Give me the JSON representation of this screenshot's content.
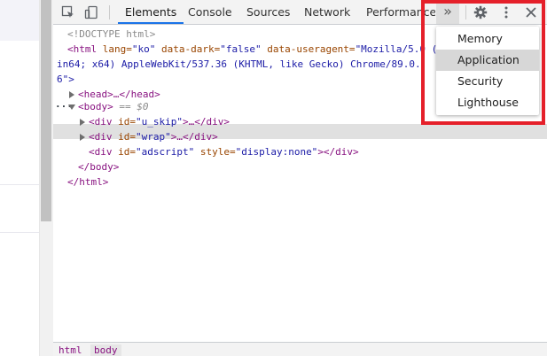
{
  "toolbar": {
    "tabs": [
      "Elements",
      "Console",
      "Sources",
      "Network",
      "Performance"
    ],
    "active_tab": "Elements",
    "overflow_label": "»",
    "icons": [
      "inspect-icon",
      "device-toggle-icon",
      "gear-icon",
      "more-vert-icon",
      "close-icon"
    ]
  },
  "code": {
    "doctype": "<!DOCTYPE html>",
    "html_open_tag": "<html",
    "html_attr1_name": " lang=",
    "html_attr1_val": "\"ko\"",
    "html_attr2_name": " data-dark=",
    "html_attr2_val": "\"false\"",
    "html_attr3_name": " data-useragent=",
    "html_attr3_val_part1": "\"Mozilla/5.0 (",
    "useragent_line2": "in64; x64) AppleWebKit/537.36 (KHTML, like Gecko) Chrome/89.0.",
    "useragent_line3": "6\">",
    "head_line": "<head>…</head>",
    "body_line": "<body>",
    "body_eq": " == $0",
    "div1": {
      "open": "<div",
      "attr": " id=",
      "val": "\"u_skip\"",
      "rest": ">…</div>"
    },
    "div2": {
      "open": "<div",
      "attr": " id=",
      "val": "\"wrap\"",
      "rest": ">…</div>"
    },
    "div3": {
      "open": "<div",
      "attr1": " id=",
      "val1": "\"adscript\"",
      "attr2": " style=",
      "val2": "\"display:none\"",
      "rest": "></div>"
    },
    "body_close": "</body>",
    "html_close": "</html>",
    "ellipsis_marker": "···"
  },
  "breadcrumbs": [
    "html",
    "body"
  ],
  "menu": {
    "items": [
      "Memory",
      "Application",
      "Security",
      "Lighthouse"
    ],
    "highlighted": "Application"
  },
  "colors": {
    "accent": "#1a73e8",
    "highlight_border": "#e5202a",
    "tag": "#881280",
    "attr": "#994500",
    "value": "#1a1aa6"
  }
}
